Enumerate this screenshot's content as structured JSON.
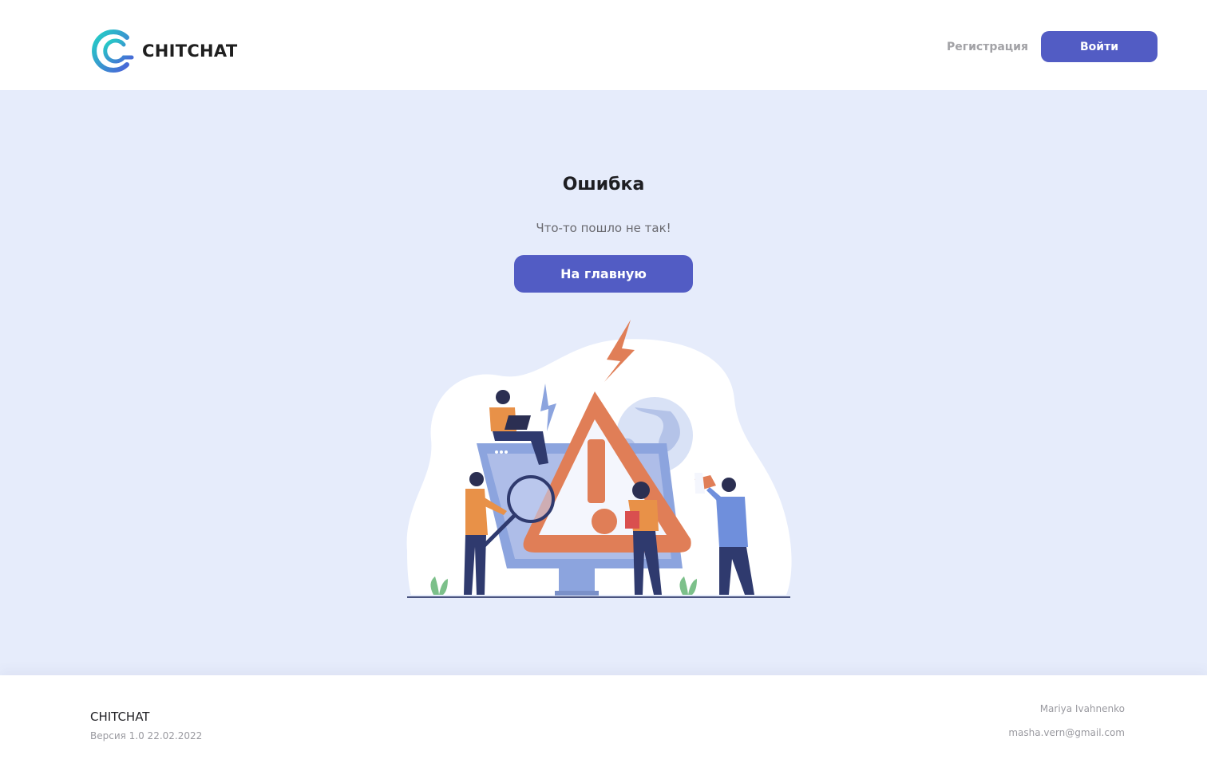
{
  "header": {
    "logo_text": "CHITCHAT",
    "register_label": "Регистрация",
    "login_label": "Войти"
  },
  "error": {
    "title": "Ошибка",
    "message": "Что-то пошло не так!",
    "home_button": "На главную"
  },
  "footer": {
    "brand": "CHITCHAT",
    "version": "Версия 1.0 22.02.2022",
    "author": "Mariya Ivahnenko",
    "email": "masha.vern@gmail.com"
  },
  "colors": {
    "accent": "#525cc4",
    "main_background": "#e6ecfb",
    "warning": "#e07e57"
  },
  "icons": [
    "chitchat-logo",
    "warning-triangle-illustration",
    "lightning-icon",
    "globe-icon",
    "magnifier-icon",
    "megaphone-icon"
  ]
}
